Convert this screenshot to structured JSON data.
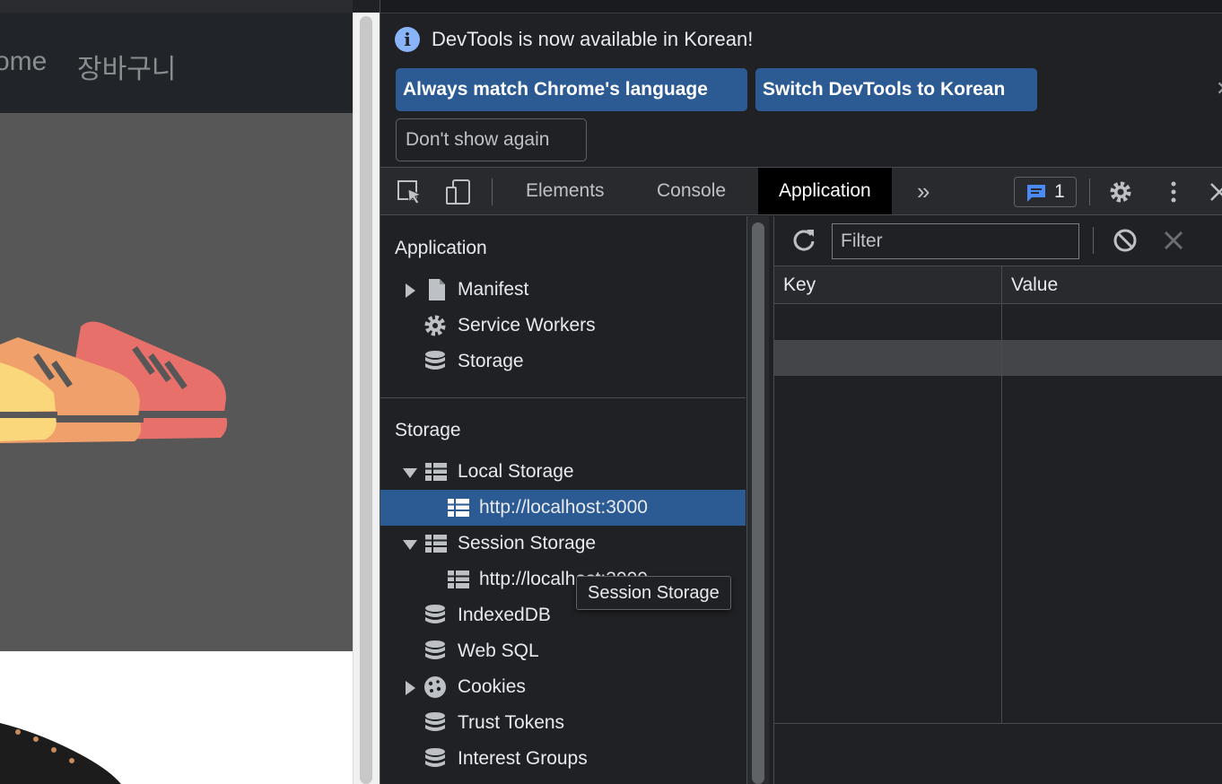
{
  "webpage": {
    "nav_links": [
      "ome",
      "장바구니"
    ]
  },
  "devtools": {
    "infobar": {
      "message": "DevTools is now available in Korean!",
      "always_match_label": "Always match Chrome's language",
      "switch_label": "Switch DevTools to Korean",
      "dont_show_label": "Don't show again"
    },
    "tabs": {
      "elements": "Elements",
      "console": "Console",
      "application": "Application",
      "more": "»"
    },
    "issues_count": "1",
    "sidebar": {
      "application_title": "Application",
      "manifest": "Manifest",
      "service_workers": "Service Workers",
      "storage_item": "Storage",
      "storage_title": "Storage",
      "local_storage": "Local Storage",
      "local_storage_origin": "http://localhost:3000",
      "session_storage": "Session Storage",
      "session_storage_origin": "http://localhost:3000",
      "indexeddb": "IndexedDB",
      "web_sql": "Web SQL",
      "cookies": "Cookies",
      "trust_tokens": "Trust Tokens",
      "interest_groups": "Interest Groups",
      "tooltip": "Session Storage"
    },
    "storage_view": {
      "filter_placeholder": "Filter",
      "key_header": "Key",
      "value_header": "Value"
    }
  },
  "colors": {
    "devtools_bg": "#202124",
    "selected_row": "#2c5b94",
    "accent_button": "#2c5b94",
    "shoe_red": "#e8706b",
    "shoe_orange": "#f0a06a",
    "shoe_yellow": "#f9d77a"
  }
}
